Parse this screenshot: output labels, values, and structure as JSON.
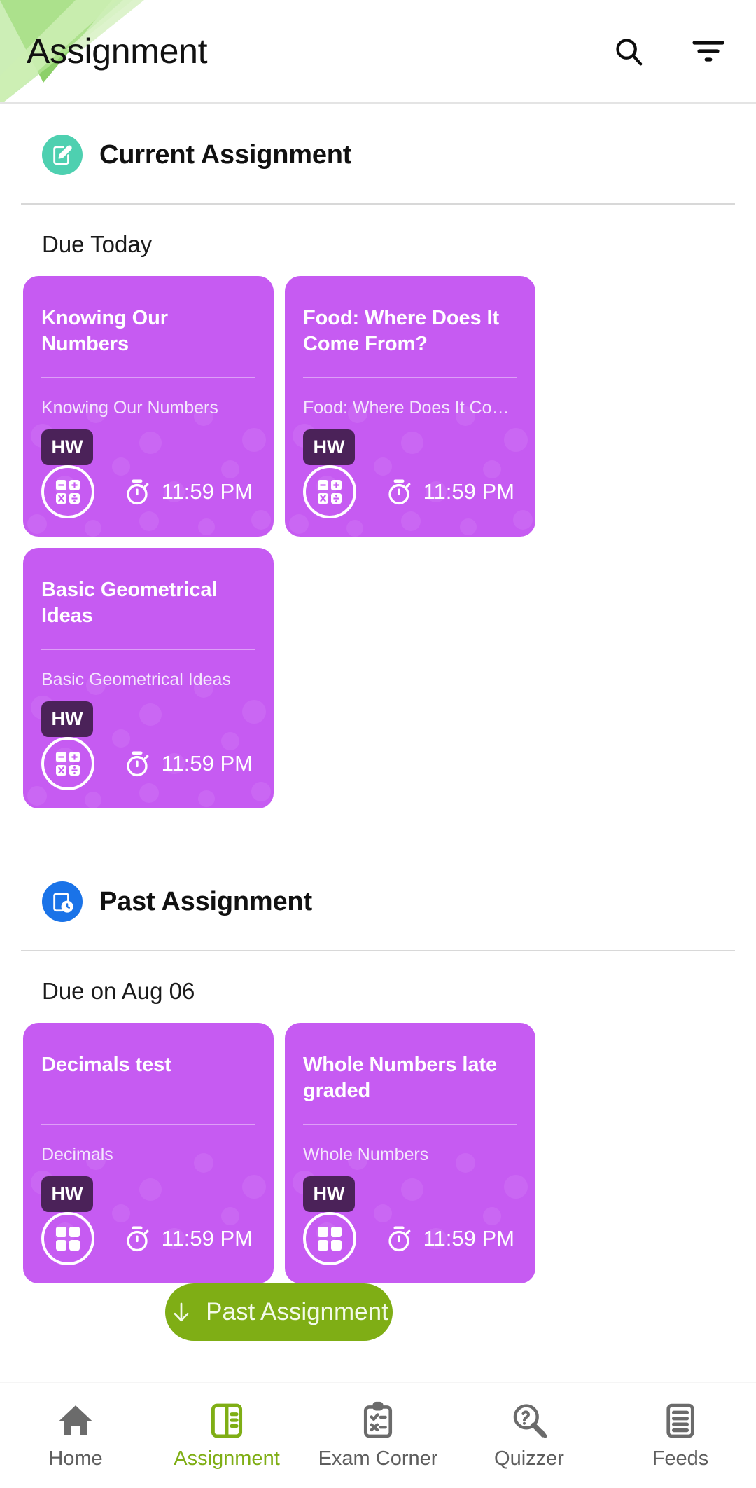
{
  "header": {
    "title": "Assignment",
    "search_icon": "search-icon",
    "filter_icon": "filter-icon"
  },
  "current_section": {
    "icon": "document-edit-icon",
    "icon_color": "#4ed0b0",
    "title": "Current Assignment",
    "due_label": "Due Today",
    "cards": [
      {
        "title": "Knowing Our Numbers",
        "subtitle": "Knowing Our Numbers",
        "badge": "HW",
        "subject_icon": "calculator-icon",
        "time_icon": "stopwatch-icon",
        "time": "11:59 PM"
      },
      {
        "title": "Food: Where Does It Come From?",
        "subtitle": "Food: Where Does It Come Fro...",
        "badge": "HW",
        "subject_icon": "calculator-icon",
        "time_icon": "stopwatch-icon",
        "time": "11:59 PM"
      },
      {
        "title": "Basic Geometrical Ideas",
        "subtitle": "Basic Geometrical Ideas",
        "badge": "HW",
        "subject_icon": "calculator-icon",
        "time_icon": "stopwatch-icon",
        "time": "11:59 PM"
      }
    ]
  },
  "past_section": {
    "icon": "document-clock-icon",
    "icon_color": "#1a73e8",
    "title": "Past Assignment",
    "due_label": "Due on Aug 06",
    "cards": [
      {
        "title": "Decimals test",
        "subtitle": "Decimals",
        "badge": "HW",
        "subject_icon": "calculator-icon",
        "time_icon": "stopwatch-icon",
        "time": "11:59 PM"
      },
      {
        "title": "Whole Numbers late graded",
        "subtitle": "Whole Numbers",
        "badge": "HW",
        "subject_icon": "calculator-icon",
        "time_icon": "stopwatch-icon",
        "time": "11:59 PM"
      }
    ]
  },
  "fab": {
    "label": "Past Assignment",
    "icon": "arrow-down-icon",
    "color": "#7fae15"
  },
  "bottom_nav": {
    "active_index": 1,
    "items": [
      {
        "label": "Home",
        "icon": "home-icon"
      },
      {
        "label": "Assignment",
        "icon": "book-icon"
      },
      {
        "label": "Exam Corner",
        "icon": "clipboard-check-icon"
      },
      {
        "label": "Quizzer",
        "icon": "quiz-magnifier-icon"
      },
      {
        "label": "Feeds",
        "icon": "feed-list-icon"
      }
    ]
  },
  "theme": {
    "card_purple": "#c65bf2",
    "badge_purple": "#4b2259",
    "accent_green": "#7fae15",
    "teal": "#4ed0b0",
    "blue": "#1a73e8"
  }
}
